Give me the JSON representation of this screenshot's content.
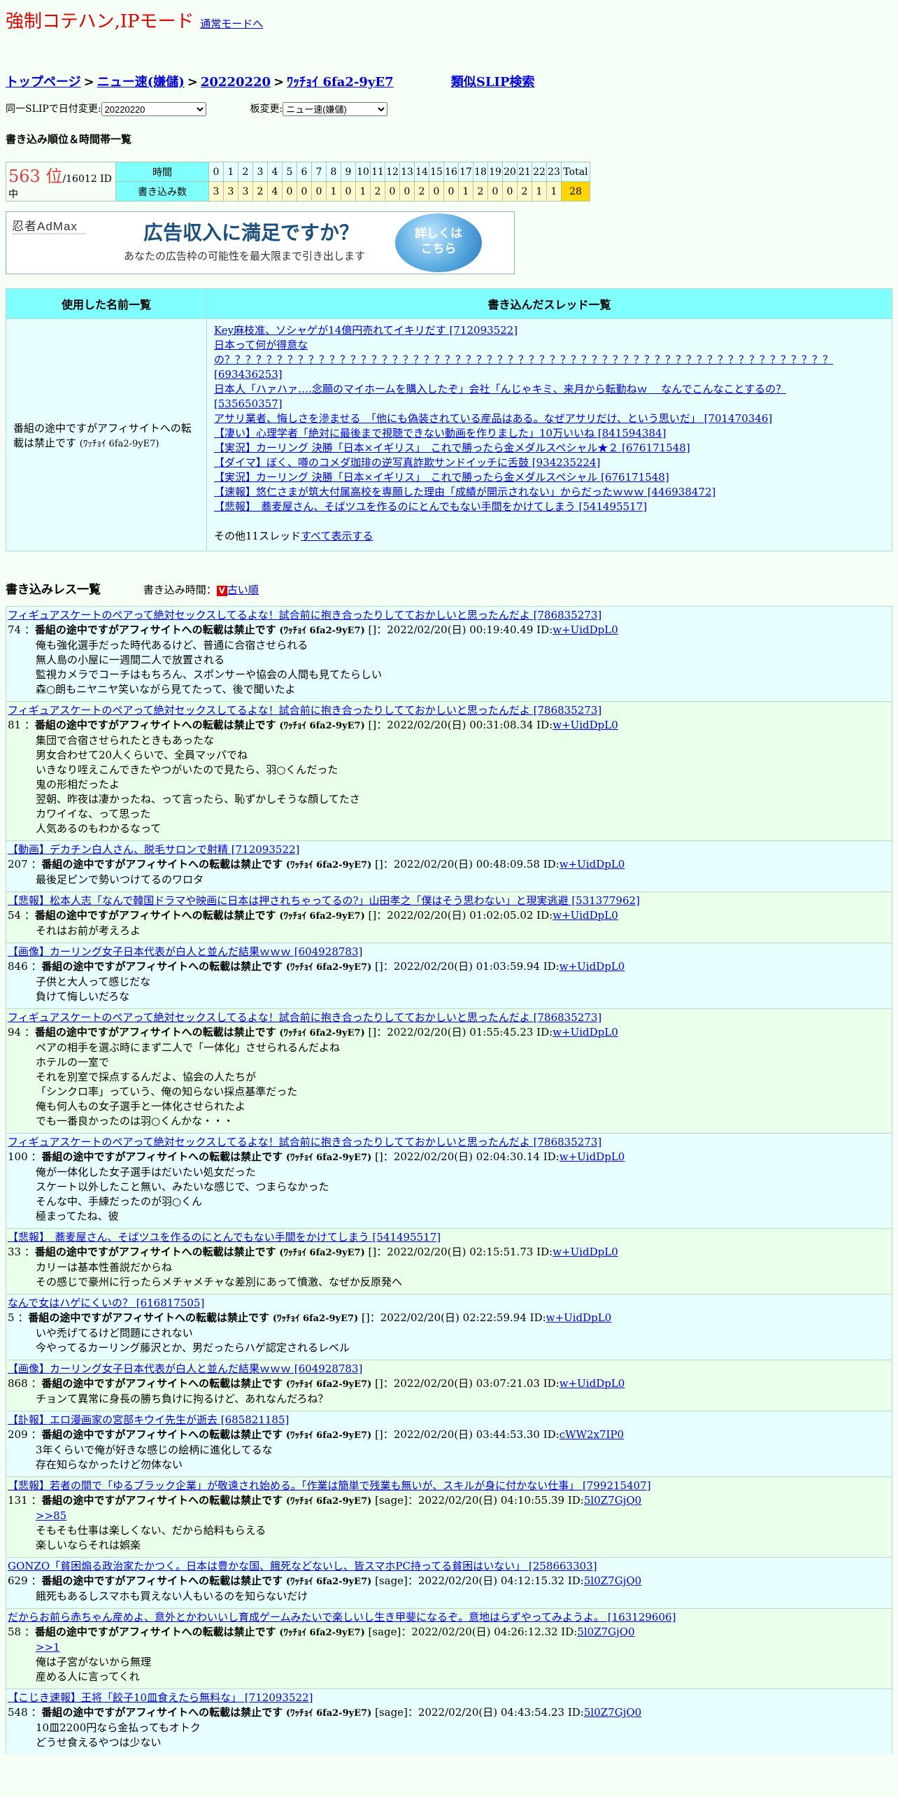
{
  "header": {
    "title": "強制コテハン,IPモード",
    "mode_link": "通常モードへ"
  },
  "breadcrumb": {
    "top": "トップページ",
    "board": "ニュー速(嫌儲)",
    "date": "20220220",
    "slip": "ﾜｯﾁｮｲ 6fa2-9yE7",
    "sep": ">",
    "similar": "類似SLIP検索"
  },
  "selectors": {
    "date_label": "同一SLIPで日付変更:",
    "date_value": "20220220",
    "board_label": "板変更:",
    "board_value": "ニュー速(嫌儲)"
  },
  "ranking": {
    "heading": "書き込み順位＆時間帯一覧",
    "rank": "563 位",
    "total": "/16012 ID中",
    "time_label": "時間",
    "count_label": "書き込み数",
    "total_label": "Total",
    "hours": [
      "0",
      "1",
      "2",
      "3",
      "4",
      "5",
      "6",
      "7",
      "8",
      "9",
      "10",
      "11",
      "12",
      "13",
      "14",
      "15",
      "16",
      "17",
      "18",
      "19",
      "20",
      "21",
      "22",
      "23"
    ],
    "counts": [
      "3",
      "3",
      "3",
      "2",
      "4",
      "0",
      "0",
      "0",
      "1",
      "0",
      "1",
      "2",
      "0",
      "0",
      "2",
      "0",
      "0",
      "1",
      "2",
      "0",
      "0",
      "2",
      "1",
      "1"
    ],
    "total_count": "28"
  },
  "ad": {
    "brand": "忍者AdMax",
    "main": "広告収入に満足ですか？",
    "sub": "あなたの広告枠の可能性を最大限まで引き出します",
    "badge": "詳しくは\nこちら"
  },
  "names_table": {
    "col1": "使用した名前一覧",
    "col2": "書き込んだスレッド一覧",
    "name": "番組の途中ですがアフィサイトへの転載は禁止です",
    "name_slip": "(ﾜｯﾁｮｲ 6fa2-9yE7)",
    "threads": [
      "Key麻枝准、ソシャゲが14億円売れてイキリだす [712093522]",
      "日本って何が得意な",
      "の？？？？？？？？？？？？？？？？？？？？？？？？？？？？？？？？？？？？？？？？？？？？？？？？？？？？？？？？？？ [693436253]",
      "日本人「ハァハァ‥‥念願のマイホームを購入したぞ」会社「んじゃキミ、来月から転勤ねｗ　 なんでこんなことするの？",
      "[535650357]",
      "アサリ業者、悔しさを滲ませる　「他にも偽装されている産品はある。なぜアサリだけ、という思いだ」 [701470346]",
      "【凄い】心理学者「絶対に最後まで視聴できない動画を作りました」10万いいね [841594384]",
      "【実況】カーリング 決勝「日本×イギリス」　これで勝ったら金メダルスペシャル★２ [676171548]",
      "【ダイマ】ぼく、噂のコメダ珈琲の逆写真詐欺サンドイッチに舌鼓 [934235224]",
      "【実況】カーリング 決勝「日本×イギリス」　これで勝ったら金メダルスペシャル [676171548]",
      "【速報】悠仁さまが筑大付属高校を専願した理由「成績が開示されない」からだったｗｗｗ [446938472]",
      "【悲報】　蕎麦屋さん、そばツユを作るのにとんでもない手間をかけてしまう [541495517]"
    ],
    "more_prefix": "その他11スレッド",
    "more_link": "すべて表示する"
  },
  "posts_section": {
    "title": "書き込みレス一覧",
    "order_label": "書き込み時間：",
    "order_icon": "V",
    "order_link": "古い順"
  },
  "posts": [
    {
      "thread": "フィギュアスケートのペアって絶対セックスしてるよな！試合前に抱き合ったりしてておかしいと思ったんだよ [786835273]",
      "num": "74",
      "name": "番組の途中ですがアフィサイトへの転載は禁止です",
      "slip": "(ﾜｯﾁｮｲ 6fa2-9yE7)",
      "mail": "[]",
      "date": "2022/02/20(日) 00:19:40.49 ID:",
      "id": "w+UidDpL0",
      "lines": [
        "俺も強化選手だった時代あるけど、普通に合宿させられる",
        "無人島の小屋に一週間二人で放置される",
        "監視カメラでコーチはもちろん、スポンサーや協会の人間も見てたらしい",
        "森○朗もニヤニヤ笑いながら見てたって、後で聞いたよ"
      ]
    },
    {
      "thread": "フィギュアスケートのペアって絶対セックスしてるよな！試合前に抱き合ったりしてておかしいと思ったんだよ [786835273]",
      "num": "81",
      "name": "番組の途中ですがアフィサイトへの転載は禁止です",
      "slip": "(ﾜｯﾁｮｲ 6fa2-9yE7)",
      "mail": "[]",
      "date": "2022/02/20(日) 00:31:08.34 ID:",
      "id": "w+UidDpL0",
      "lines": [
        "集団で合宿させられたときもあったな",
        "男女合わせて20人くらいで、全員マッパでね",
        "いきなり咥えこんできたやつがいたので見たら、羽○くんだった",
        "鬼の形相だったよ",
        "翌朝、昨夜は凄かったね、って言ったら、恥ずかしそうな顔してたさ",
        "カワイイな、って思った",
        "人気あるのもわかるなって"
      ]
    },
    {
      "thread": "【動画】デカチン白人さん、脱毛サロンで射精 [712093522]",
      "num": "207",
      "name": "番組の途中ですがアフィサイトへの転載は禁止です",
      "slip": "(ﾜｯﾁｮｲ 6fa2-9yE7)",
      "mail": "[]",
      "date": "2022/02/20(日) 00:48:09.58 ID:",
      "id": "w+UidDpL0",
      "lines": [
        "最後足ピンで勢いつけてるのワロタ"
      ]
    },
    {
      "thread": "【悲報】松本人志「なんで韓国ドラマや映画に日本は押されちゃってるの?」山田孝之「僕はそう思わない」と現実逃避 [531377962]",
      "num": "54",
      "name": "番組の途中ですがアフィサイトへの転載は禁止です",
      "slip": "(ﾜｯﾁｮｲ 6fa2-9yE7)",
      "mail": "[]",
      "date": "2022/02/20(日) 01:02:05.02 ID:",
      "id": "w+UidDpL0",
      "lines": [
        "それはお前が考えろよ"
      ]
    },
    {
      "thread": "【画像】カーリング女子日本代表が白人と並んだ結果ｗｗｗ [604928783]",
      "num": "846",
      "name": "番組の途中ですがアフィサイトへの転載は禁止です",
      "slip": "(ﾜｯﾁｮｲ 6fa2-9yE7)",
      "mail": "[]",
      "date": "2022/02/20(日) 01:03:59.94 ID:",
      "id": "w+UidDpL0",
      "lines": [
        "子供と大人って感じだな",
        "負けて悔しいだろな"
      ]
    },
    {
      "thread": "フィギュアスケートのペアって絶対セックスしてるよな！試合前に抱き合ったりしてておかしいと思ったんだよ [786835273]",
      "num": "94",
      "name": "番組の途中ですがアフィサイトへの転載は禁止です",
      "slip": "(ﾜｯﾁｮｲ 6fa2-9yE7)",
      "mail": "[]",
      "date": "2022/02/20(日) 01:55:45.23 ID:",
      "id": "w+UidDpL0",
      "lines": [
        "ペアの相手を選ぶ時にまず二人で「一体化」させられるんだよね",
        "ホテルの一室で",
        "それを別室で採点するんだよ、協会の人たちが",
        "「シンクロ率」っていう、俺の知らない採点基準だった",
        "俺も何人もの女子選手と一体化させられたよ",
        "でも一番良かったのは羽○くんかな・・・"
      ]
    },
    {
      "thread": "フィギュアスケートのペアって絶対セックスしてるよな！試合前に抱き合ったりしてておかしいと思ったんだよ [786835273]",
      "num": "100",
      "name": "番組の途中ですがアフィサイトへの転載は禁止です",
      "slip": "(ﾜｯﾁｮｲ 6fa2-9yE7)",
      "mail": "[]",
      "date": "2022/02/20(日) 02:04:30.14 ID:",
      "id": "w+UidDpL0",
      "lines": [
        "俺が一体化した女子選手はだいたい処女だった",
        "スケート以外したこと無い、みたいな感じで、つまらなかった",
        "そんな中、手練だったのが羽○くん",
        "極まってたね、彼"
      ]
    },
    {
      "thread": "【悲報】　蕎麦屋さん、そばツユを作るのにとんでもない手間をかけてしまう [541495517]",
      "num": "33",
      "name": "番組の途中ですがアフィサイトへの転載は禁止です",
      "slip": "(ﾜｯﾁｮｲ 6fa2-9yE7)",
      "mail": "[]",
      "date": "2022/02/20(日) 02:15:51.73 ID:",
      "id": "w+UidDpL0",
      "lines": [
        "カリーは基本性善説だからね",
        "その感じで豪州に行ったらメチャメチャな差別にあって憤激、なぜか反原発へ"
      ]
    },
    {
      "thread": "なんで女はハゲにくいの？ [616817505]",
      "num": "5",
      "name": "番組の途中ですがアフィサイトへの転載は禁止です",
      "slip": "(ﾜｯﾁｮｲ 6fa2-9yE7)",
      "mail": "[]",
      "date": "2022/02/20(日) 02:22:59.94 ID:",
      "id": "w+UidDpL0",
      "lines": [
        "いや禿げてるけど問題にされない",
        "今やってるカーリング藤沢とか、男だったらハゲ認定されるレベル"
      ]
    },
    {
      "thread": "【画像】カーリング女子日本代表が白人と並んだ結果ｗｗｗ [604928783]",
      "num": "868",
      "name": "番組の途中ですがアフィサイトへの転載は禁止です",
      "slip": "(ﾜｯﾁｮｲ 6fa2-9yE7)",
      "mail": "[]",
      "date": "2022/02/20(日) 03:07:21.03 ID:",
      "id": "w+UidDpL0",
      "lines": [
        "チョンて異常に身長の勝ち負けに拘るけど、あれなんだろね？"
      ]
    },
    {
      "thread": "【訃報】エロ漫画家の宮部キウイ先生が逝去 [685821185]",
      "num": "209",
      "name": "番組の途中ですがアフィサイトへの転載は禁止です",
      "slip": "(ﾜｯﾁｮｲ 6fa2-9yE7)",
      "mail": "[]",
      "date": "2022/02/20(日) 03:44:53.30 ID:",
      "id": "cWW2x7IP0",
      "lines": [
        "3年くらいで俺が好きな感じの絵柄に進化してるな",
        "存在知らなかったけど勿体ない"
      ]
    },
    {
      "thread": "【悲報】若者の間で「ゆるブラック企業」が敬遠され始める。「作業は簡単で残業も無いが、スキルが身に付かない仕事」 [799215407]",
      "num": "131",
      "name": "番組の途中ですがアフィサイトへの転載は禁止です",
      "slip": "(ﾜｯﾁｮｲ 6fa2-9yE7)",
      "mail": "[sage]",
      "date": "2022/02/20(日) 04:10:55.39 ID:",
      "id": "5l0Z7GjQ0",
      "reply": ">>85",
      "lines": [
        "そもそも仕事は楽しくない、だから給料もらえる",
        "楽しいならそれは娯楽"
      ]
    },
    {
      "thread": "GONZO「貧困煽る政治家たかつく。日本は豊かな国、餓死などないし、皆スマホPC持ってる貧困はいない」 [258663303]",
      "num": "629",
      "name": "番組の途中ですがアフィサイトへの転載は禁止です",
      "slip": "(ﾜｯﾁｮｲ 6fa2-9yE7)",
      "mail": "[sage]",
      "date": "2022/02/20(日) 04:12:15.32 ID:",
      "id": "5l0Z7GjQ0",
      "lines": [
        "餓死もあるしスマホも買えない人もいるのを知らないだけ"
      ]
    },
    {
      "thread": "だからお前ら赤ちゃん産めよ、意外とかわいいし育成ゲームみたいで楽しいし生き甲斐になるぞ。意地はらずやってみようよ。 [163129606]",
      "num": "58",
      "name": "番組の途中ですがアフィサイトへの転載は禁止です",
      "slip": "(ﾜｯﾁｮｲ 6fa2-9yE7)",
      "mail": "[sage]",
      "date": "2022/02/20(日) 04:26:12.32 ID:",
      "id": "5l0Z7GjQ0",
      "reply": ">>1",
      "lines": [
        "俺は子宮がないから無理",
        "産める人に言ってくれ"
      ]
    },
    {
      "thread": "【こじき速報】王将「餃子10皿食えたら無料な」 [712093522]",
      "num": "548",
      "name": "番組の途中ですがアフィサイトへの転載は禁止です",
      "slip": "(ﾜｯﾁｮｲ 6fa2-9yE7)",
      "mail": "[sage]",
      "date": "2022/02/20(日) 04:43:54.23 ID:",
      "id": "5l0Z7GjQ0",
      "lines": [
        "10皿2200円なら金払ってもオトク",
        "どうせ食えるやつは少ない"
      ]
    }
  ]
}
